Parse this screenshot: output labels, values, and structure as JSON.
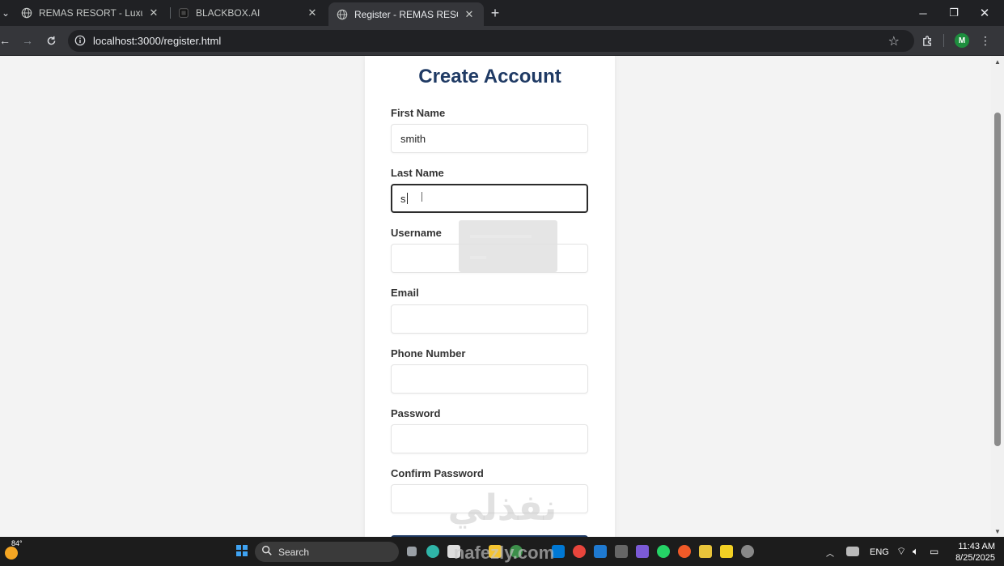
{
  "browser": {
    "tabs": [
      {
        "title": "REMAS RESORT - Luxury Chalets",
        "active": false
      },
      {
        "title": "BLACKBOX.AI",
        "active": false
      },
      {
        "title": "Register - REMAS RESORT",
        "active": true
      }
    ],
    "address": "localhost:3000/register.html",
    "profile_initial": "M"
  },
  "form": {
    "title": "Create Account",
    "fields": [
      {
        "label": "First Name",
        "value": "smith"
      },
      {
        "label": "Last Name",
        "value": "s"
      },
      {
        "label": "Username",
        "value": ""
      },
      {
        "label": "Email",
        "value": ""
      },
      {
        "label": "Phone Number",
        "value": ""
      },
      {
        "label": "Password",
        "value": ""
      },
      {
        "label": "Confirm Password",
        "value": ""
      }
    ],
    "accent_color": "#1f3a64"
  },
  "taskbar": {
    "temperature": "84°",
    "search_label": "Search",
    "language": "ENG",
    "time": "11:43 AM",
    "date": "8/25/2025"
  },
  "watermark": {
    "arabic": "نفذلي",
    "latin": "nafezly.com"
  }
}
